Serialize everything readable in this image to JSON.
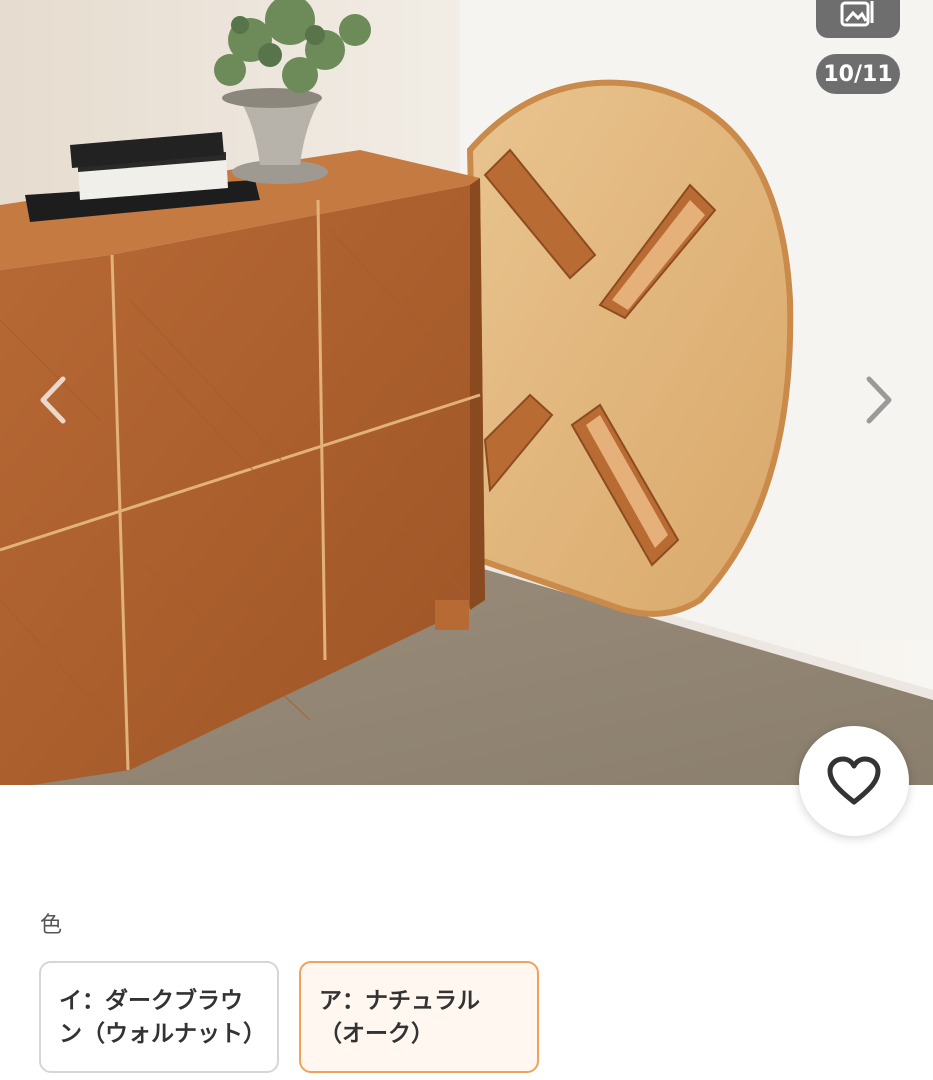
{
  "gallery": {
    "counter": "10/11",
    "gallery_icon": "gallery-image-icon",
    "prev_icon": "chevron-left-icon",
    "next_icon": "chevron-right-icon",
    "like_icon": "heart-outline-icon",
    "photo": "Wooden cabinet beside a folded oval table leaning against the wall"
  },
  "color_selector": {
    "label": "色",
    "options": [
      {
        "label": "イ：ダークブラウン（ウォルナット）",
        "selected": false
      },
      {
        "label": "ア：ナチュラル（オーク）",
        "selected": true
      }
    ]
  },
  "colors": {
    "accent": "#f0a25a",
    "badge_bg": "#6e6e6e"
  }
}
